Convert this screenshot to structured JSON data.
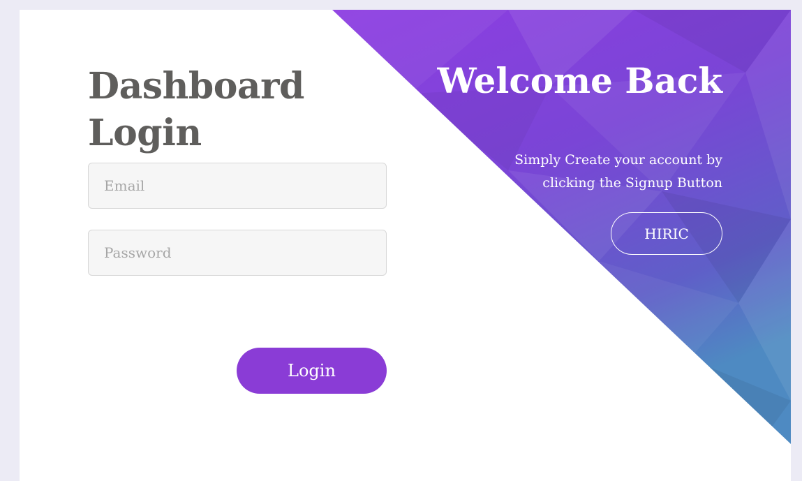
{
  "login_panel": {
    "title_line1": "Dashboard",
    "title_line2": "Login",
    "email_placeholder": "Email",
    "password_placeholder": "Password",
    "login_label": "Login"
  },
  "welcome_panel": {
    "heading": "Welcome Back",
    "subtext_line1": "Simply Create your account by",
    "subtext_line2": "clicking the Signup Button",
    "button_label": "HIRIC"
  },
  "colors": {
    "accent": "#8a3cd6",
    "title_text": "#5f5e5c",
    "gradient_top": "#8b3fe0",
    "gradient_mid": "#6a4fcc",
    "gradient_bottom": "#4e86c4",
    "page_background": "#ecebf5"
  }
}
